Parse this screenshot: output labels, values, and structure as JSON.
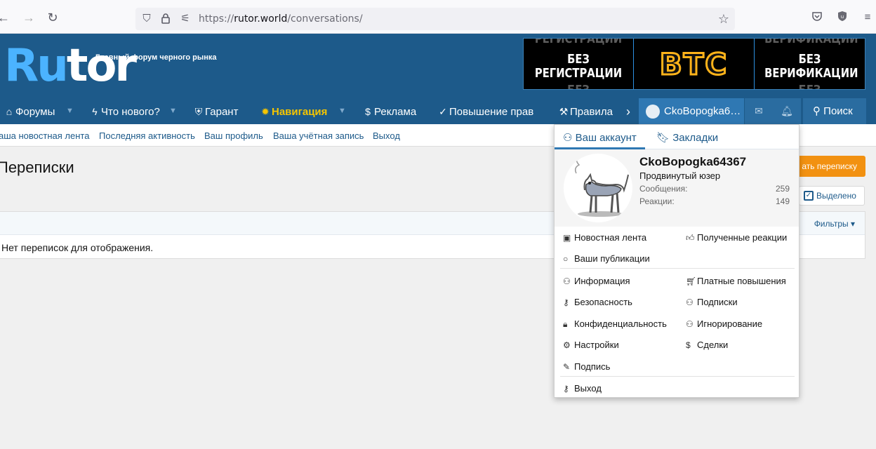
{
  "browser": {
    "url_prefix": "https://",
    "url_host": "rutor.world",
    "url_path": "/conversations/"
  },
  "site": {
    "logo_part1": "Ru",
    "logo_part2": "tor",
    "tagline": "Главный форум черного рынка",
    "banner": {
      "left_text_1": "БЕЗ",
      "left_text_2": "РЕГИСТРАЦИИ",
      "left_ghost_top": "РЕГИСТРАЦИИ",
      "left_ghost_bottom": "БЕЗ",
      "middle_text": "BTC",
      "right_text_1": "БЕЗ",
      "right_text_2": "ВЕРИФИКАЦИИ",
      "right_ghost_top": "ВЕРИФИКАЦИИ",
      "right_ghost_bottom": "БЕЗ"
    }
  },
  "nav": {
    "forums": "Форумы",
    "whats_new": "Что нового?",
    "guarantee": "Гарант",
    "navigation": "Навигация",
    "ads": "Реклама",
    "upgrade": "Повышение прав",
    "rules": "Правила",
    "user": "CkoBopogka6…",
    "search": "Поиск"
  },
  "subnav": {
    "items": [
      "аша новостная лента",
      "Последняя активность",
      "Ваш профиль",
      "Ваша учётная запись",
      "Выход"
    ]
  },
  "page": {
    "title": "Переписки",
    "start_button": "ать переписку",
    "selected_button": "Выделено",
    "filters": "Фильтры",
    "empty_message": "Нет переписок для отображения."
  },
  "menu": {
    "tab_account": "Ваш аккаунт",
    "tab_bookmarks": "Закладки",
    "username": "CkoBopogka64367",
    "user_title": "Продвинутый юзер",
    "messages_label": "Сообщения:",
    "messages_value": "259",
    "reactions_label": "Реакции:",
    "reactions_value": "149",
    "news_feed": "Новостная лента",
    "received_reactions": "Полученные реакции",
    "your_posts": "Ваши публикации",
    "information": "Информация",
    "paid_upgrades": "Платные повышения",
    "security": "Безопасность",
    "following": "Подписки",
    "privacy": "Конфиденциальность",
    "ignoring": "Игнорирование",
    "settings": "Настройки",
    "deals": "Сделки",
    "signature": "Подпись",
    "logout": "Выход"
  }
}
